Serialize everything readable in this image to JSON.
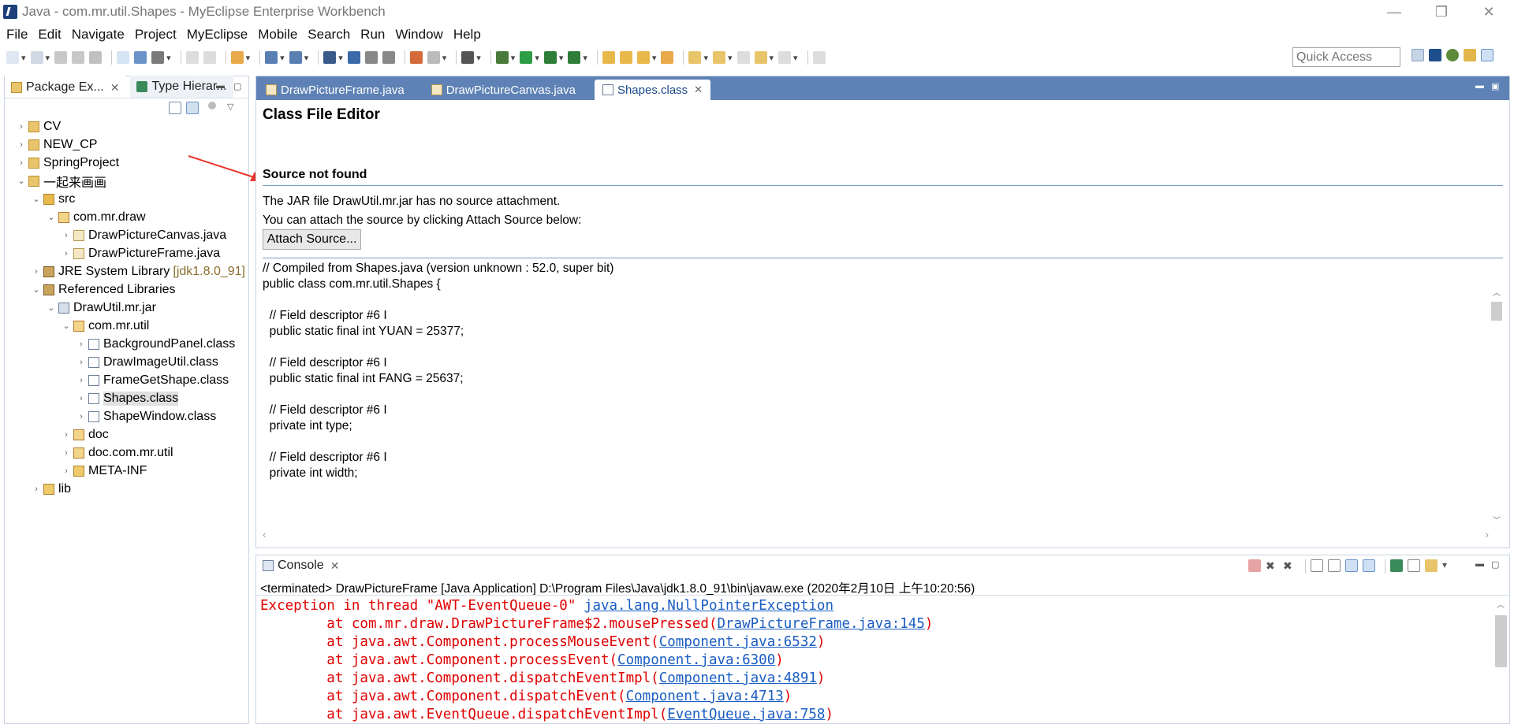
{
  "window": {
    "title": "Java - com.mr.util.Shapes - MyEclipse Enterprise Workbench",
    "minimize": "—",
    "restore": "❐",
    "close": "✕"
  },
  "menu": [
    "File",
    "Edit",
    "Navigate",
    "Project",
    "MyEclipse",
    "Mobile",
    "Search",
    "Run",
    "Window",
    "Help"
  ],
  "toolbar": {
    "quick_access_placeholder": "Quick Access"
  },
  "left_panel": {
    "tabs": [
      {
        "label": "Package Ex...",
        "close": "✕"
      },
      {
        "label": "Type Hierar...",
        "close": ""
      }
    ],
    "tree": [
      {
        "label": "CV",
        "indent": 0,
        "twisty": "›",
        "icon": "project-icon"
      },
      {
        "label": "NEW_CP",
        "indent": 0,
        "twisty": "›",
        "icon": "project-icon"
      },
      {
        "label": "SpringProject",
        "indent": 0,
        "twisty": "›",
        "icon": "project-icon"
      },
      {
        "label": "一起来画画",
        "indent": 0,
        "twisty": "⌄",
        "icon": "project-icon"
      },
      {
        "label": "src",
        "indent": 1,
        "twisty": "⌄",
        "icon": "source-folder-icon"
      },
      {
        "label": "com.mr.draw",
        "indent": 2,
        "twisty": "⌄",
        "icon": "package-icon"
      },
      {
        "label": "DrawPictureCanvas.java",
        "indent": 3,
        "twisty": "›",
        "icon": "java-file-icon"
      },
      {
        "label": "DrawPictureFrame.java",
        "indent": 3,
        "twisty": "›",
        "icon": "java-file-icon"
      },
      {
        "label": "JRE System Library",
        "suffix": "[jdk1.8.0_91]",
        "indent": 1,
        "twisty": "›",
        "icon": "library-icon"
      },
      {
        "label": "Referenced Libraries",
        "indent": 1,
        "twisty": "⌄",
        "icon": "library-icon"
      },
      {
        "label": "DrawUtil.mr.jar",
        "indent": 2,
        "twisty": "⌄",
        "icon": "jar-icon"
      },
      {
        "label": "com.mr.util",
        "indent": 3,
        "twisty": "⌄",
        "icon": "package-icon"
      },
      {
        "label": "BackgroundPanel.class",
        "indent": 4,
        "twisty": "›",
        "icon": "class-file-icon"
      },
      {
        "label": "DrawImageUtil.class",
        "indent": 4,
        "twisty": "›",
        "icon": "class-file-icon"
      },
      {
        "label": "FrameGetShape.class",
        "indent": 4,
        "twisty": "›",
        "icon": "class-file-icon"
      },
      {
        "label": "Shapes.class",
        "indent": 4,
        "twisty": "›",
        "icon": "class-file-icon",
        "selected": true
      },
      {
        "label": "ShapeWindow.class",
        "indent": 4,
        "twisty": "›",
        "icon": "class-file-icon"
      },
      {
        "label": "doc",
        "indent": 3,
        "twisty": "›",
        "icon": "package-icon"
      },
      {
        "label": "doc.com.mr.util",
        "indent": 3,
        "twisty": "›",
        "icon": "package-icon"
      },
      {
        "label": "META-INF",
        "indent": 3,
        "twisty": "›",
        "icon": "folder-icon"
      },
      {
        "label": "lib",
        "indent": 1,
        "twisty": "›",
        "icon": "folder-icon"
      }
    ]
  },
  "editor": {
    "tabs": [
      {
        "label": "DrawPictureFrame.java",
        "active": false
      },
      {
        "label": "DrawPictureCanvas.java",
        "active": false
      },
      {
        "label": "Shapes.class",
        "active": true,
        "close": "✕"
      }
    ],
    "heading": "Class File Editor",
    "source_not_found": "Source not found",
    "message_line1": "The JAR file DrawUtil.mr.jar has no source attachment.",
    "message_line2": "You can attach the source by clicking Attach Source below:",
    "attach_button": "Attach Source...",
    "code": [
      "// Compiled from Shapes.java (version unknown : 52.0, super bit)",
      "public class com.mr.util.Shapes {",
      "",
      "  // Field descriptor #6 I",
      "  public static final int YUAN = 25377;",
      "",
      "  // Field descriptor #6 I",
      "  public static final int FANG = 25637;",
      "",
      "  // Field descriptor #6 I",
      "  private int type;",
      "",
      "  // Field descriptor #6 I",
      "  private int width;"
    ]
  },
  "console": {
    "tab_label": "Console",
    "tab_close": "✕",
    "status": "<terminated> DrawPictureFrame [Java Application] D:\\Program Files\\Java\\jdk1.8.0_91\\bin\\javaw.exe (2020年2月10日 上午10:20:56)",
    "lines": [
      {
        "pre": "Exception in thread \"AWT-EventQueue-0\" ",
        "link": "java.lang.NullPointerException",
        "post": ""
      },
      {
        "pre": "\tat com.mr.draw.DrawPictureFrame$2.mousePressed(",
        "link": "DrawPictureFrame.java:145",
        "post": ")"
      },
      {
        "pre": "\tat java.awt.Component.processMouseEvent(",
        "link": "Component.java:6532",
        "post": ")"
      },
      {
        "pre": "\tat java.awt.Component.processEvent(",
        "link": "Component.java:6300",
        "post": ")"
      },
      {
        "pre": "\tat java.awt.Component.dispatchEventImpl(",
        "link": "Component.java:4891",
        "post": ")"
      },
      {
        "pre": "\tat java.awt.Component.dispatchEvent(",
        "link": "Component.java:4713",
        "post": ")"
      },
      {
        "pre": "\tat java.awt.EventQueue.dispatchEventImpl(",
        "link": "EventQueue.java:758",
        "post": ")"
      }
    ]
  },
  "colors": {
    "editor_tab_bar": "#5e82b5",
    "error_text": "#e00000",
    "link": "#1a5dc2",
    "annotation_arrow": "#e8352b"
  }
}
